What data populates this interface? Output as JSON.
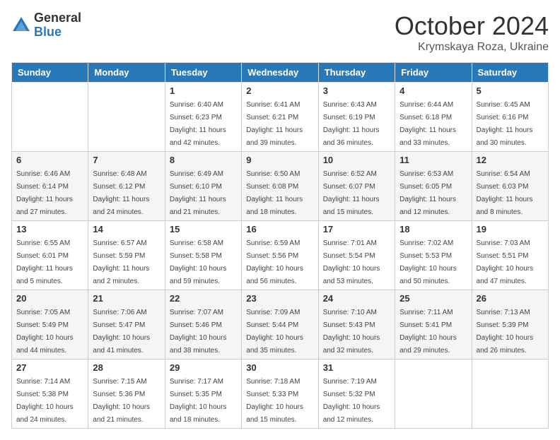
{
  "logo": {
    "general": "General",
    "blue": "Blue"
  },
  "title": {
    "month": "October 2024",
    "location": "Krymskaya Roza, Ukraine"
  },
  "headers": [
    "Sunday",
    "Monday",
    "Tuesday",
    "Wednesday",
    "Thursday",
    "Friday",
    "Saturday"
  ],
  "weeks": [
    [
      {
        "day": "",
        "sunrise": "",
        "sunset": "",
        "daylight": ""
      },
      {
        "day": "",
        "sunrise": "",
        "sunset": "",
        "daylight": ""
      },
      {
        "day": "1",
        "sunrise": "Sunrise: 6:40 AM",
        "sunset": "Sunset: 6:23 PM",
        "daylight": "Daylight: 11 hours and 42 minutes."
      },
      {
        "day": "2",
        "sunrise": "Sunrise: 6:41 AM",
        "sunset": "Sunset: 6:21 PM",
        "daylight": "Daylight: 11 hours and 39 minutes."
      },
      {
        "day": "3",
        "sunrise": "Sunrise: 6:43 AM",
        "sunset": "Sunset: 6:19 PM",
        "daylight": "Daylight: 11 hours and 36 minutes."
      },
      {
        "day": "4",
        "sunrise": "Sunrise: 6:44 AM",
        "sunset": "Sunset: 6:18 PM",
        "daylight": "Daylight: 11 hours and 33 minutes."
      },
      {
        "day": "5",
        "sunrise": "Sunrise: 6:45 AM",
        "sunset": "Sunset: 6:16 PM",
        "daylight": "Daylight: 11 hours and 30 minutes."
      }
    ],
    [
      {
        "day": "6",
        "sunrise": "Sunrise: 6:46 AM",
        "sunset": "Sunset: 6:14 PM",
        "daylight": "Daylight: 11 hours and 27 minutes."
      },
      {
        "day": "7",
        "sunrise": "Sunrise: 6:48 AM",
        "sunset": "Sunset: 6:12 PM",
        "daylight": "Daylight: 11 hours and 24 minutes."
      },
      {
        "day": "8",
        "sunrise": "Sunrise: 6:49 AM",
        "sunset": "Sunset: 6:10 PM",
        "daylight": "Daylight: 11 hours and 21 minutes."
      },
      {
        "day": "9",
        "sunrise": "Sunrise: 6:50 AM",
        "sunset": "Sunset: 6:08 PM",
        "daylight": "Daylight: 11 hours and 18 minutes."
      },
      {
        "day": "10",
        "sunrise": "Sunrise: 6:52 AM",
        "sunset": "Sunset: 6:07 PM",
        "daylight": "Daylight: 11 hours and 15 minutes."
      },
      {
        "day": "11",
        "sunrise": "Sunrise: 6:53 AM",
        "sunset": "Sunset: 6:05 PM",
        "daylight": "Daylight: 11 hours and 12 minutes."
      },
      {
        "day": "12",
        "sunrise": "Sunrise: 6:54 AM",
        "sunset": "Sunset: 6:03 PM",
        "daylight": "Daylight: 11 hours and 8 minutes."
      }
    ],
    [
      {
        "day": "13",
        "sunrise": "Sunrise: 6:55 AM",
        "sunset": "Sunset: 6:01 PM",
        "daylight": "Daylight: 11 hours and 5 minutes."
      },
      {
        "day": "14",
        "sunrise": "Sunrise: 6:57 AM",
        "sunset": "Sunset: 5:59 PM",
        "daylight": "Daylight: 11 hours and 2 minutes."
      },
      {
        "day": "15",
        "sunrise": "Sunrise: 6:58 AM",
        "sunset": "Sunset: 5:58 PM",
        "daylight": "Daylight: 10 hours and 59 minutes."
      },
      {
        "day": "16",
        "sunrise": "Sunrise: 6:59 AM",
        "sunset": "Sunset: 5:56 PM",
        "daylight": "Daylight: 10 hours and 56 minutes."
      },
      {
        "day": "17",
        "sunrise": "Sunrise: 7:01 AM",
        "sunset": "Sunset: 5:54 PM",
        "daylight": "Daylight: 10 hours and 53 minutes."
      },
      {
        "day": "18",
        "sunrise": "Sunrise: 7:02 AM",
        "sunset": "Sunset: 5:53 PM",
        "daylight": "Daylight: 10 hours and 50 minutes."
      },
      {
        "day": "19",
        "sunrise": "Sunrise: 7:03 AM",
        "sunset": "Sunset: 5:51 PM",
        "daylight": "Daylight: 10 hours and 47 minutes."
      }
    ],
    [
      {
        "day": "20",
        "sunrise": "Sunrise: 7:05 AM",
        "sunset": "Sunset: 5:49 PM",
        "daylight": "Daylight: 10 hours and 44 minutes."
      },
      {
        "day": "21",
        "sunrise": "Sunrise: 7:06 AM",
        "sunset": "Sunset: 5:47 PM",
        "daylight": "Daylight: 10 hours and 41 minutes."
      },
      {
        "day": "22",
        "sunrise": "Sunrise: 7:07 AM",
        "sunset": "Sunset: 5:46 PM",
        "daylight": "Daylight: 10 hours and 38 minutes."
      },
      {
        "day": "23",
        "sunrise": "Sunrise: 7:09 AM",
        "sunset": "Sunset: 5:44 PM",
        "daylight": "Daylight: 10 hours and 35 minutes."
      },
      {
        "day": "24",
        "sunrise": "Sunrise: 7:10 AM",
        "sunset": "Sunset: 5:43 PM",
        "daylight": "Daylight: 10 hours and 32 minutes."
      },
      {
        "day": "25",
        "sunrise": "Sunrise: 7:11 AM",
        "sunset": "Sunset: 5:41 PM",
        "daylight": "Daylight: 10 hours and 29 minutes."
      },
      {
        "day": "26",
        "sunrise": "Sunrise: 7:13 AM",
        "sunset": "Sunset: 5:39 PM",
        "daylight": "Daylight: 10 hours and 26 minutes."
      }
    ],
    [
      {
        "day": "27",
        "sunrise": "Sunrise: 7:14 AM",
        "sunset": "Sunset: 5:38 PM",
        "daylight": "Daylight: 10 hours and 24 minutes."
      },
      {
        "day": "28",
        "sunrise": "Sunrise: 7:15 AM",
        "sunset": "Sunset: 5:36 PM",
        "daylight": "Daylight: 10 hours and 21 minutes."
      },
      {
        "day": "29",
        "sunrise": "Sunrise: 7:17 AM",
        "sunset": "Sunset: 5:35 PM",
        "daylight": "Daylight: 10 hours and 18 minutes."
      },
      {
        "day": "30",
        "sunrise": "Sunrise: 7:18 AM",
        "sunset": "Sunset: 5:33 PM",
        "daylight": "Daylight: 10 hours and 15 minutes."
      },
      {
        "day": "31",
        "sunrise": "Sunrise: 7:19 AM",
        "sunset": "Sunset: 5:32 PM",
        "daylight": "Daylight: 10 hours and 12 minutes."
      },
      {
        "day": "",
        "sunrise": "",
        "sunset": "",
        "daylight": ""
      },
      {
        "day": "",
        "sunrise": "",
        "sunset": "",
        "daylight": ""
      }
    ]
  ]
}
